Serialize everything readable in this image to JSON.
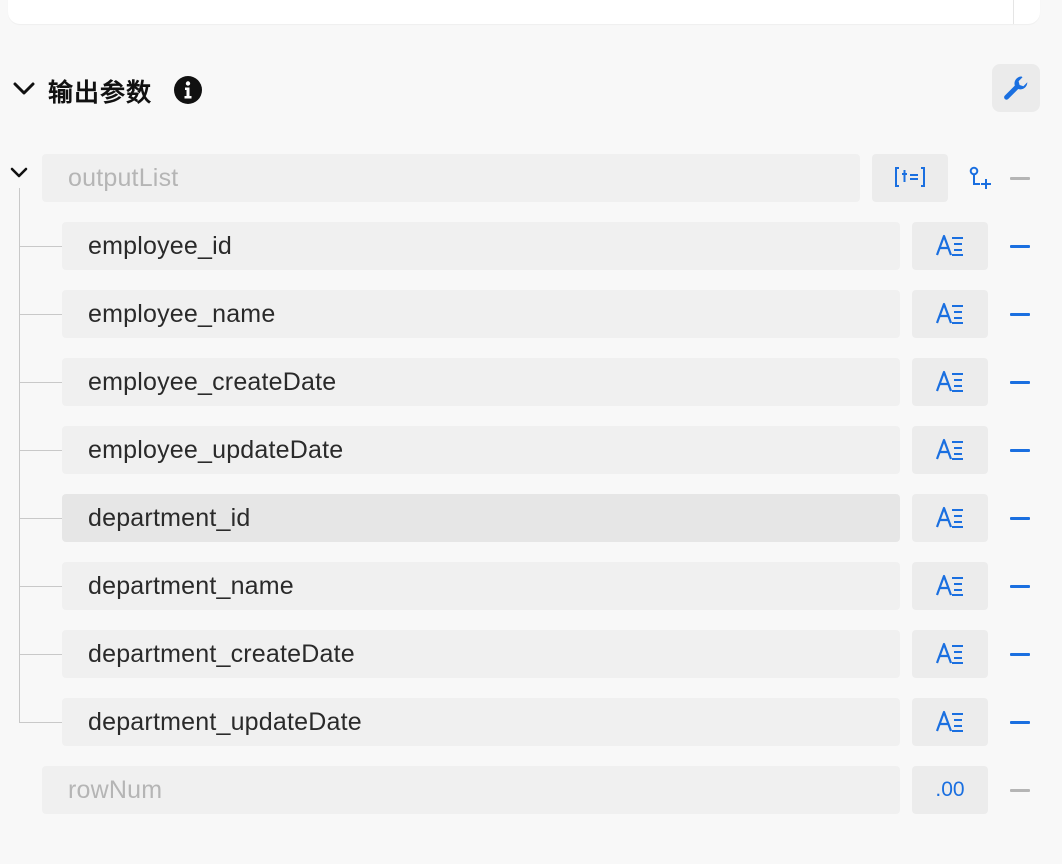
{
  "header": {
    "title": "输出参数",
    "info_icon": "info-circle-icon",
    "settings_icon": "wrench-icon"
  },
  "colors": {
    "accent": "#1a6fe0",
    "muted": "#b5b5b5",
    "field_bg": "#f0f0f0"
  },
  "root": {
    "placeholder": "outputList",
    "type_icon": "array-type-icon",
    "add_child_icon": "add-child-node-icon",
    "remove_icon": "minus-icon"
  },
  "fields": [
    {
      "name": "employee_id",
      "type_icon": "string-type-icon"
    },
    {
      "name": "employee_name",
      "type_icon": "string-type-icon"
    },
    {
      "name": "employee_createDate",
      "type_icon": "string-type-icon"
    },
    {
      "name": "employee_updateDate",
      "type_icon": "string-type-icon"
    },
    {
      "name": "department_id",
      "type_icon": "string-type-icon"
    },
    {
      "name": "department_name",
      "type_icon": "string-type-icon"
    },
    {
      "name": "department_createDate",
      "type_icon": "string-type-icon"
    },
    {
      "name": "department_updateDate",
      "type_icon": "string-type-icon"
    }
  ],
  "row_num": {
    "placeholder": "rowNum",
    "type_label": ".00"
  }
}
